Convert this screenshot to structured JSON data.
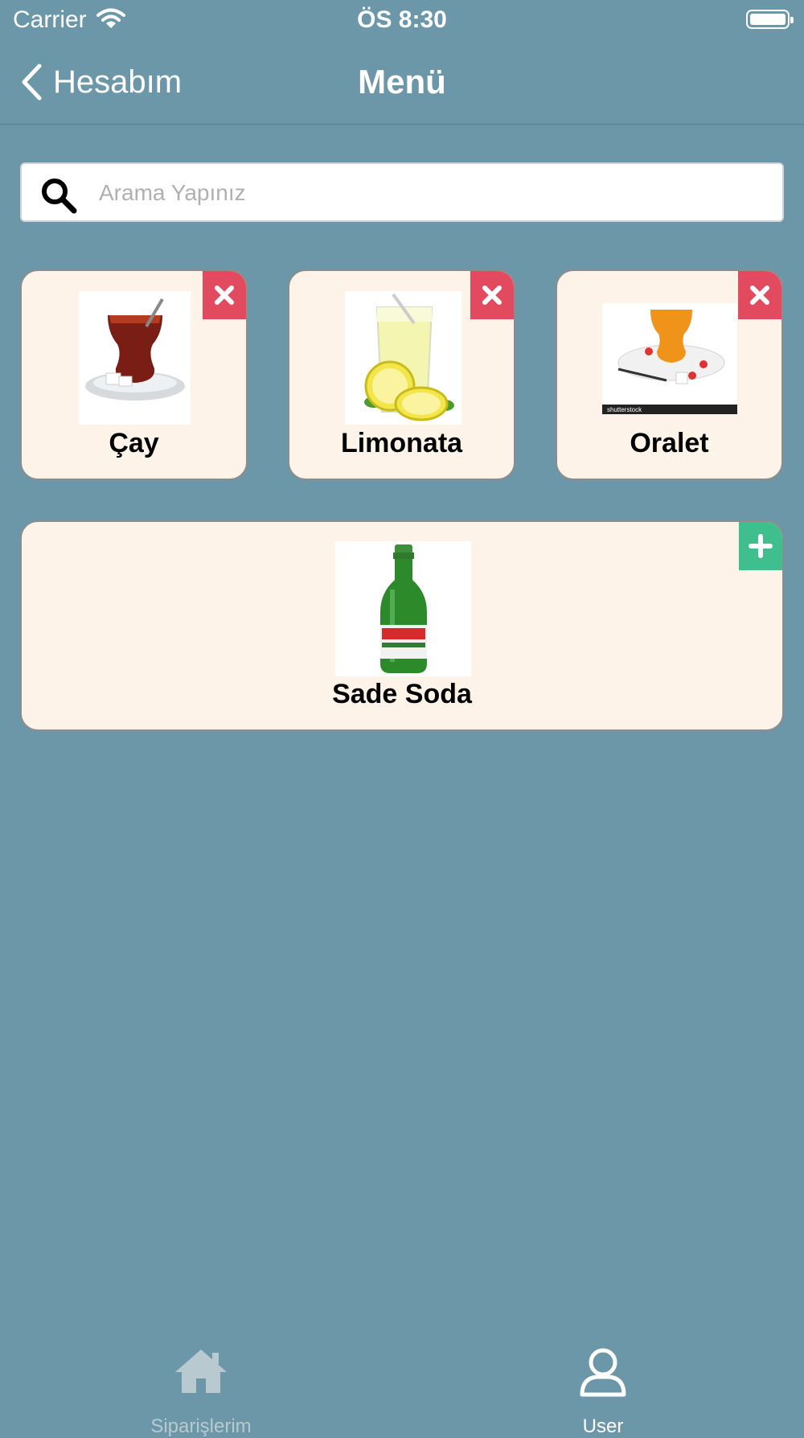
{
  "status_bar": {
    "carrier": "Carrier",
    "time": "ÖS 8:30"
  },
  "nav": {
    "back_label": "Hesabım",
    "title": "Menü"
  },
  "search": {
    "placeholder": "Arama Yapınız"
  },
  "products": [
    {
      "name": "Çay",
      "action": "remove",
      "icon": "tea-glass-image"
    },
    {
      "name": "Limonata",
      "action": "remove",
      "icon": "lemonade-image"
    },
    {
      "name": "Oralet",
      "action": "remove",
      "icon": "oralet-image",
      "watermark": "shutterstock"
    },
    {
      "name": "Sade Soda",
      "action": "add",
      "icon": "soda-bottle-image"
    }
  ],
  "tabs": [
    {
      "label": "Siparişlerim",
      "icon": "home-icon",
      "active": false
    },
    {
      "label": "User",
      "icon": "user-icon",
      "active": true
    }
  ],
  "colors": {
    "background": "#6c97a8",
    "card": "#fdf3e8",
    "remove_badge": "#e24a60",
    "add_badge": "#3fbf8e",
    "inactive_tab": "#b8c9cf"
  }
}
